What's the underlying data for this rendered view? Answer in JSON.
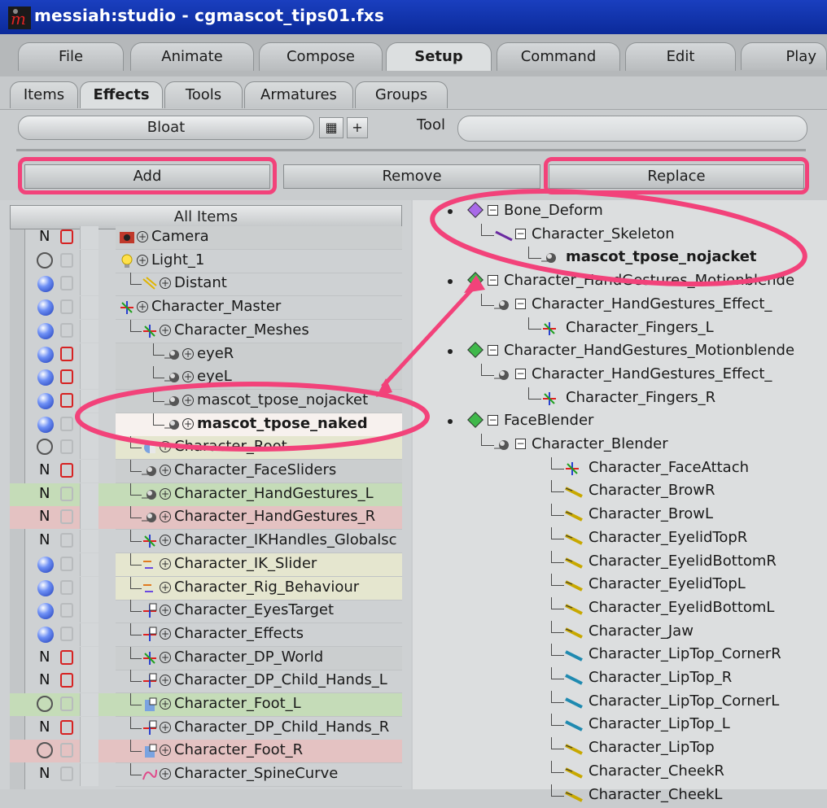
{
  "window": {
    "title": "messiah:studio - cgmascot_tips01.fxs"
  },
  "menu_tabs": [
    {
      "label": "File"
    },
    {
      "label": "Animate"
    },
    {
      "label": "Compose"
    },
    {
      "label": "Setup",
      "active": true
    },
    {
      "label": "Command"
    },
    {
      "label": "Edit"
    },
    {
      "label": "Play"
    }
  ],
  "sub_tabs": [
    {
      "label": "Items"
    },
    {
      "label": "Effects",
      "active": true
    },
    {
      "label": "Tools"
    },
    {
      "label": "Armatures"
    },
    {
      "label": "Groups"
    }
  ],
  "effect_selector": {
    "value": "Bloat",
    "plus_label": "+"
  },
  "tool": {
    "label": "Tool",
    "value": ""
  },
  "actions": {
    "add": "Add",
    "remove": "Remove",
    "replace": "Replace"
  },
  "items_list": {
    "header": "All Items",
    "rows": [
      {
        "label": "Camera"
      },
      {
        "label": "Light_1"
      },
      {
        "label": "Distant"
      },
      {
        "label": "Character_Master"
      },
      {
        "label": "Character_Meshes"
      },
      {
        "label": "eyeR"
      },
      {
        "label": "eyeL"
      },
      {
        "label": "mascot_tpose_nojacket"
      },
      {
        "label": "mascot_tpose_naked"
      },
      {
        "label": "Character_Root"
      },
      {
        "label": "Character_FaceSliders"
      },
      {
        "label": "Character_HandGestures_L"
      },
      {
        "label": "Character_HandGestures_R"
      },
      {
        "label": "Character_IKHandles_Globalsc"
      },
      {
        "label": "Character_IK_Slider"
      },
      {
        "label": "Character_Rig_Behaviour"
      },
      {
        "label": "Character_EyesTarget"
      },
      {
        "label": "Character_Effects"
      },
      {
        "label": "Character_DP_World"
      },
      {
        "label": "Character_DP_Child_Hands_L"
      },
      {
        "label": "Character_Foot_L"
      },
      {
        "label": "Character_DP_Child_Hands_R"
      },
      {
        "label": "Character_Foot_R"
      },
      {
        "label": "Character_SpineCurve"
      }
    ],
    "flag_N": "N"
  },
  "effects_tree": {
    "rows": [
      {
        "label": "Bone_Deform"
      },
      {
        "label": "Character_Skeleton"
      },
      {
        "label": "mascot_tpose_nojacket"
      },
      {
        "label": "Character_HandGestures_Motionblende"
      },
      {
        "label": "Character_HandGestures_Effect_"
      },
      {
        "label": "Character_Fingers_L"
      },
      {
        "label": "Character_HandGestures_Motionblende"
      },
      {
        "label": "Character_HandGestures_Effect_"
      },
      {
        "label": "Character_Fingers_R"
      },
      {
        "label": "FaceBlender"
      },
      {
        "label": "Character_Blender"
      },
      {
        "label": "Character_FaceAttach"
      },
      {
        "label": "Character_BrowR"
      },
      {
        "label": "Character_BrowL"
      },
      {
        "label": "Character_EyelidTopR"
      },
      {
        "label": "Character_EyelidBottomR"
      },
      {
        "label": "Character_EyelidTopL"
      },
      {
        "label": "Character_EyelidBottomL"
      },
      {
        "label": "Character_Jaw"
      },
      {
        "label": "Character_LipTop_CornerR"
      },
      {
        "label": "Character_LipTop_R"
      },
      {
        "label": "Character_LipTop_CornerL"
      },
      {
        "label": "Character_LipTop_L"
      },
      {
        "label": "Character_LipTop"
      },
      {
        "label": "Character_CheekR"
      },
      {
        "label": "Character_CheekL"
      }
    ]
  },
  "colors": {
    "highlight": "#f2427a",
    "title_bar": "#1a3fbf",
    "deform_diamond": "#a86ae8",
    "blend_diamond": "#3fb84a"
  }
}
